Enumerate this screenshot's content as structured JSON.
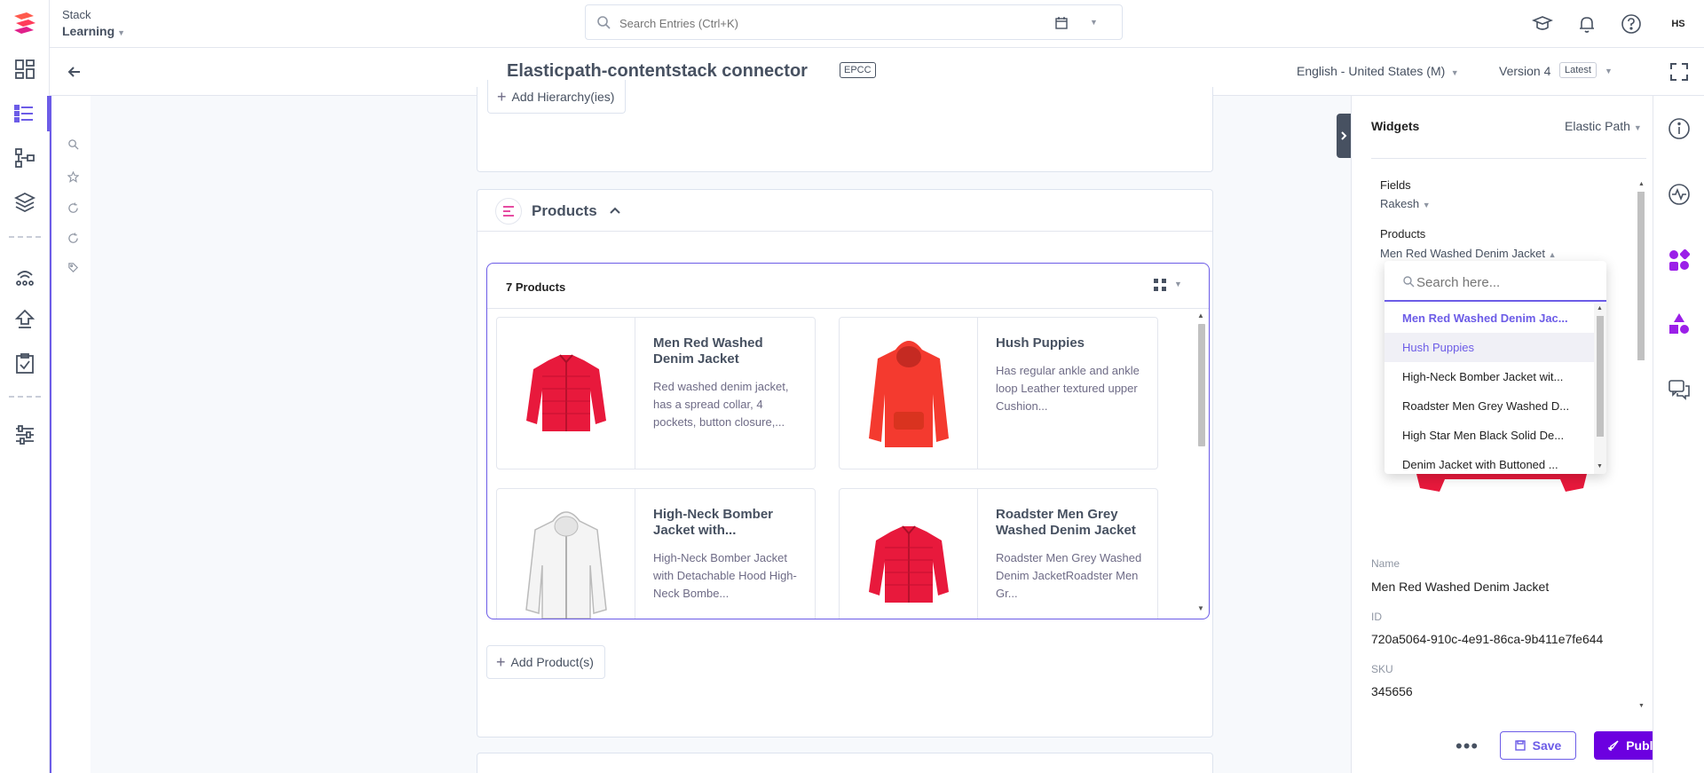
{
  "app": {
    "stack_name": "Stack",
    "branch": "Learning",
    "search_placeholder": "Search Entries (Ctrl+K)",
    "user_initials": "HS"
  },
  "entry": {
    "title": "Elasticpath-contentstack connector",
    "badge": "EPCC",
    "locale": "English - United States (M)",
    "version": "Version 4",
    "version_badge": "Latest"
  },
  "main": {
    "add_hierarchy_label": "Add Hierarchy(ies)",
    "products_section_title": "Products",
    "products_count": "7 Products",
    "products": [
      {
        "name": "Men Red Washed Denim Jacket",
        "description": "Red washed denim jacket, has a spread collar, 4 pockets, button closure,..."
      },
      {
        "name": "Hush Puppies",
        "description": "Has regular ankle and ankle loop Leather textured upper Cushion..."
      },
      {
        "name": "High-Neck Bomber Jacket with...",
        "description": "High-Neck Bomber Jacket with Detachable Hood High-Neck Bombe..."
      },
      {
        "name": "Roadster Men Grey Washed Denim Jacket",
        "description": "Roadster Men Grey Washed Denim JacketRoadster Men Gr..."
      }
    ],
    "add_product_label": "Add Product(s)"
  },
  "widgets": {
    "title": "Widgets",
    "selected_widget": "Elastic Path",
    "fields_label": "Fields",
    "fields_value": "Rakesh",
    "products_label": "Products",
    "products_value": "Men Red Washed Denim Jacket",
    "dropdown": {
      "search_placeholder": "Search here...",
      "options": [
        "Men Red Washed Denim Jac...",
        "Hush Puppies",
        "High-Neck Bomber Jacket wit...",
        "Roadster Men Grey Washed D...",
        "High Star Men Black Solid De...",
        "Denim Jacket with Buttoned ..."
      ]
    },
    "name_label": "Name",
    "name_value": "Men Red Washed Denim Jacket",
    "id_label": "ID",
    "id_value": "720a5064-910c-4e91-86ca-9b411e7fe644",
    "sku_label": "SKU",
    "sku_value": "345656"
  },
  "footer": {
    "save_label": "Save",
    "publish_label": "Publish"
  },
  "colors": {
    "accent": "#6c5ce7",
    "publish": "#6c00e0",
    "product_red": "#e8193c",
    "hoodie_red": "#f43a2f",
    "text": "#475161"
  },
  "icons": {
    "left_rail": [
      "dashboard-icon",
      "entries-icon",
      "content-models-icon",
      "assets-icon",
      "releases-icon",
      "deploy-icon",
      "tasks-icon",
      "settings-icon"
    ],
    "right_rail": [
      "info-icon",
      "activity-icon",
      "widgets-icon",
      "shapes-icon",
      "comments-icon"
    ]
  }
}
